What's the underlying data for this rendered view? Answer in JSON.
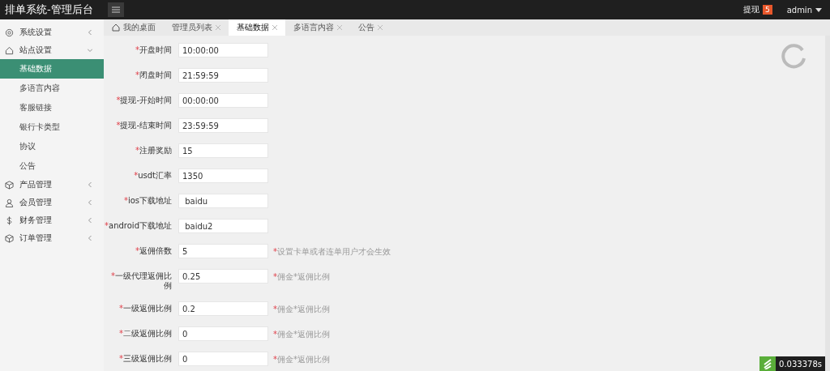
{
  "header": {
    "title": "排单系统-管理后台",
    "withdraw": {
      "label": "提现",
      "badge": "5"
    },
    "user": "admin"
  },
  "sidebar": {
    "items": [
      {
        "label": "系统设置",
        "kind": "gear",
        "expanded": false
      },
      {
        "label": "站点设置",
        "kind": "house",
        "expanded": true,
        "children": [
          {
            "label": "基础数据",
            "selected": true
          },
          {
            "label": "多语言内容",
            "selected": false
          },
          {
            "label": "客服链接",
            "selected": false
          },
          {
            "label": "银行卡类型",
            "selected": false
          },
          {
            "label": "协议",
            "selected": false
          },
          {
            "label": "公告",
            "selected": false
          }
        ]
      },
      {
        "label": "产品管理",
        "kind": "cube",
        "expanded": false
      },
      {
        "label": "会员管理",
        "kind": "person",
        "expanded": false
      },
      {
        "label": "财务管理",
        "kind": "dollar",
        "expanded": false
      },
      {
        "label": "订单管理",
        "kind": "cube",
        "expanded": false
      }
    ]
  },
  "tabs": [
    {
      "label": "我的桌面",
      "kind": "home",
      "selected": false
    },
    {
      "label": "管理员列表",
      "kind": "closable",
      "selected": false
    },
    {
      "label": "基础数据",
      "kind": "closable",
      "selected": true
    },
    {
      "label": "多语言内容",
      "kind": "closable",
      "selected": false
    },
    {
      "label": "公告",
      "kind": "closable",
      "selected": false
    }
  ],
  "form": [
    {
      "mark": "*",
      "label": "开盘时间",
      "value": "10:00:00"
    },
    {
      "mark": "*",
      "label": "闭盘时间",
      "value": "21:59:59"
    },
    {
      "mark": "*",
      "label": "提现-开始时间",
      "value": "00:00:00"
    },
    {
      "mark": "*",
      "label": "提现-结束时间",
      "value": "23:59:59"
    },
    {
      "mark": "*",
      "label": "注册奖励",
      "value": "15"
    },
    {
      "mark": "*",
      "label": "usdt汇率",
      "value": "1350"
    },
    {
      "mark": "*",
      "label": "ios下载地址",
      "value": " baidu"
    },
    {
      "mark": "*",
      "label": "android下载地址",
      "value": " baidu2"
    },
    {
      "mark": "*",
      "label": "返佣倍数",
      "value": "5",
      "hint": {
        "mark": "*",
        "text": "设置卡单或者连单用户才会生效"
      }
    },
    {
      "mark": "*",
      "label": "一级代理返佣比例",
      "value": "0.25",
      "hint": {
        "mark": "*",
        "text": "佣金*返佣比例"
      }
    },
    {
      "mark": "*",
      "label": "一级返佣比例",
      "value": "0.2",
      "hint": {
        "mark": "*",
        "text": "佣金*返佣比例"
      }
    },
    {
      "mark": "*",
      "label": "二级返佣比例",
      "value": "0",
      "hint": {
        "mark": "*",
        "text": "佣金*返佣比例"
      }
    },
    {
      "mark": "*",
      "label": "三级返佣比例",
      "value": "0",
      "hint": {
        "mark": "*",
        "text": "佣金*返佣比例"
      }
    }
  ],
  "timer": "0.033378s"
}
